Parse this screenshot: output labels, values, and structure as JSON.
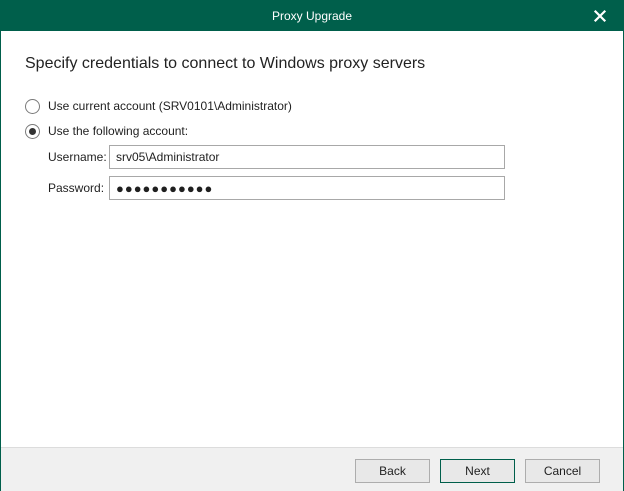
{
  "window": {
    "title": "Proxy Upgrade",
    "accent_color": "#005f4b"
  },
  "page": {
    "heading": "Specify credentials to connect to Windows proxy servers"
  },
  "options": {
    "current_account_label": "Use current account (SRV0101\\Administrator)",
    "current_account_selected": false,
    "following_account_label": "Use the following account:",
    "following_account_selected": true
  },
  "credentials": {
    "username_label": "Username:",
    "username_value": "srv05\\Administrator",
    "password_label": "Password:",
    "password_value": "●●●●●●●●●●●"
  },
  "footer": {
    "back_label": "Back",
    "next_label": "Next",
    "cancel_label": "Cancel"
  },
  "icons": {
    "close": "close-icon"
  }
}
